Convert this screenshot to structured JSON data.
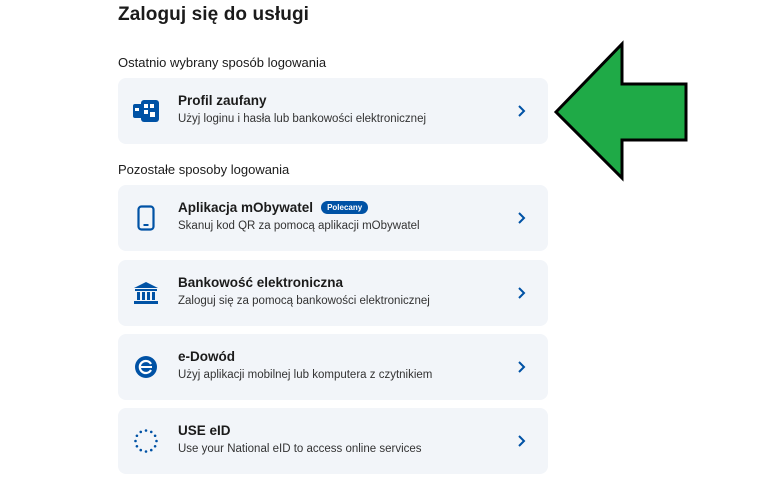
{
  "page": {
    "title": "Zaloguj się do usługi"
  },
  "sections": {
    "recent_label": "Ostatnio wybrany sposób logowania",
    "other_label": "Pozostałe sposoby logowania"
  },
  "methods": {
    "profil": {
      "title": "Profil zaufany",
      "desc": "Użyj loginu i hasła lub bankowości elektronicznej",
      "icon": "trusted-profile-icon"
    },
    "mobywatel": {
      "title": "Aplikacja mObywatel",
      "badge": "Polecany",
      "desc": "Skanuj kod QR za pomocą aplikacji mObywatel",
      "icon": "phone-icon"
    },
    "bank": {
      "title": "Bankowość elektroniczna",
      "desc": "Zaloguj się za pomocą bankowości elektronicznej",
      "icon": "bank-icon"
    },
    "edowod": {
      "title": "e-Dowód",
      "desc": "Użyj aplikacji mobilnej lub komputera z czytnikiem",
      "icon": "edowod-icon"
    },
    "eid": {
      "title": "USE eID",
      "desc": "Use your National eID to access online services",
      "icon": "eu-stars-icon"
    }
  },
  "colors": {
    "brand": "#0052a5",
    "card_bg": "#f2f5f9",
    "arrow_fill": "#1faa47",
    "arrow_stroke": "#000000"
  }
}
